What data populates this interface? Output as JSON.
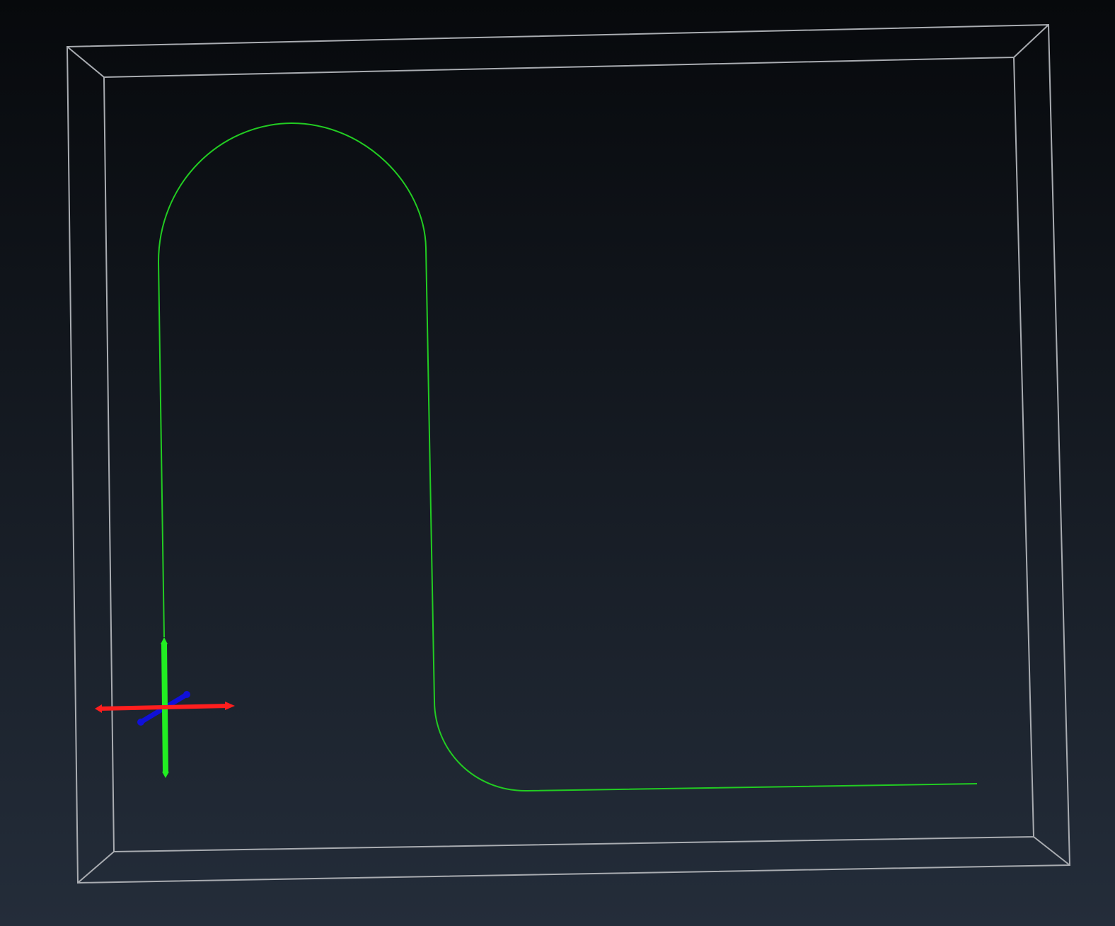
{
  "viewport": {
    "background": {
      "top_color": "#07090c",
      "bottom_color": "#242d3a"
    }
  },
  "bounding_box": {
    "edge_color": "#a9acb1"
  },
  "trajectory": {
    "color": "#22cc22",
    "description_icon": "path-line"
  },
  "axes_gizmo": {
    "x_axis_color": "#ff1e1e",
    "y_axis_color": "#22ee22",
    "z_axis_color": "#1010d8"
  }
}
